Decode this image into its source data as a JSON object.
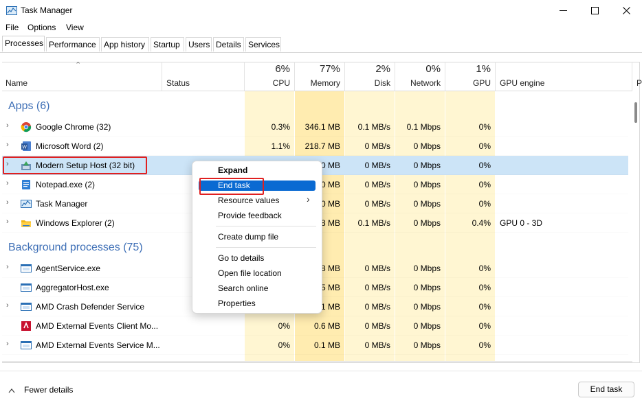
{
  "window": {
    "title": "Task Manager",
    "minimize": "—",
    "maximize": "☐",
    "close": "✕"
  },
  "menu": [
    "File",
    "Options",
    "View"
  ],
  "tabs": [
    "Processes",
    "Performance",
    "App history",
    "Startup",
    "Users",
    "Details",
    "Services"
  ],
  "columns": {
    "name": "Name",
    "status": "Status",
    "cpu": {
      "pct": "6%",
      "label": "CPU"
    },
    "memory": {
      "pct": "77%",
      "label": "Memory"
    },
    "disk": {
      "pct": "2%",
      "label": "Disk"
    },
    "network": {
      "pct": "0%",
      "label": "Network"
    },
    "gpu": {
      "pct": "1%",
      "label": "GPU"
    },
    "gpu_engine": "GPU engine",
    "extra": "P"
  },
  "groups": {
    "apps": "Apps (6)",
    "background": "Background processes (75)"
  },
  "apps": [
    {
      "name": "Google Chrome (32)",
      "cpu": "0.3%",
      "memory": "346.1 MB",
      "disk": "0.1 MB/s",
      "network": "0.1 Mbps",
      "gpu": "0%",
      "engine": ""
    },
    {
      "name": "Microsoft Word (2)",
      "cpu": "1.1%",
      "memory": "218.7 MB",
      "disk": "0 MB/s",
      "network": "0 Mbps",
      "gpu": "0%",
      "engine": ""
    },
    {
      "name": "Modern Setup Host (32 bit)",
      "cpu": "",
      "memory": "0 MB",
      "disk": "0 MB/s",
      "network": "0 Mbps",
      "gpu": "0%",
      "engine": ""
    },
    {
      "name": "Notepad.exe (2)",
      "cpu": "",
      "memory": "0 MB",
      "disk": "0 MB/s",
      "network": "0 Mbps",
      "gpu": "0%",
      "engine": ""
    },
    {
      "name": "Task Manager",
      "cpu": "",
      "memory": "0 MB",
      "disk": "0 MB/s",
      "network": "0 Mbps",
      "gpu": "0%",
      "engine": ""
    },
    {
      "name": "Windows Explorer (2)",
      "cpu": "",
      "memory": "8 MB",
      "disk": "0.1 MB/s",
      "network": "0 Mbps",
      "gpu": "0.4%",
      "engine": "GPU 0 - 3D"
    }
  ],
  "background": [
    {
      "name": "AgentService.exe",
      "cpu": "",
      "memory": "8 MB",
      "disk": "0 MB/s",
      "network": "0 Mbps",
      "gpu": "0%"
    },
    {
      "name": "AggregatorHost.exe",
      "cpu": "",
      "memory": "5 MB",
      "disk": "0 MB/s",
      "network": "0 Mbps",
      "gpu": "0%"
    },
    {
      "name": "AMD Crash Defender Service",
      "cpu": "",
      "memory": "1 MB",
      "disk": "0 MB/s",
      "network": "0 Mbps",
      "gpu": "0%"
    },
    {
      "name": "AMD External Events Client Mo...",
      "cpu": "0%",
      "memory": "0.6 MB",
      "disk": "0 MB/s",
      "network": "0 Mbps",
      "gpu": "0%"
    },
    {
      "name": "AMD External Events Service M...",
      "cpu": "0%",
      "memory": "0.1 MB",
      "disk": "0 MB/s",
      "network": "0 Mbps",
      "gpu": "0%"
    }
  ],
  "context_menu": [
    "Expand",
    "End task",
    "Resource values",
    "Provide feedback",
    "Create dump file",
    "Go to details",
    "Open file location",
    "Search online",
    "Properties"
  ],
  "context_submenu_arrow": "›",
  "footer": {
    "fewer": "Fewer details",
    "end_task": "End task"
  },
  "colors": {
    "accent": "#0a6ad2",
    "highlight_row": "#cce4f7",
    "annotation": "#e02020",
    "heat_light": "#fff4c4",
    "heat_mid": "#ffe9a8",
    "group_text": "#3e6fb6"
  }
}
